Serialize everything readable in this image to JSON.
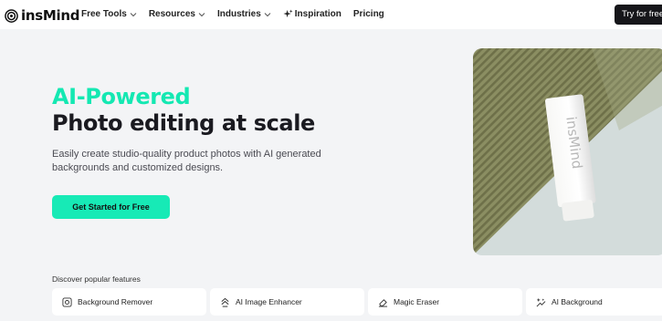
{
  "brand": {
    "name": "insMind"
  },
  "nav": {
    "items": [
      {
        "label": "Free Tools",
        "icon": "chevron-down-icon"
      },
      {
        "label": "Resources",
        "icon": "chevron-down-icon"
      },
      {
        "label": "Industries",
        "icon": "chevron-down-icon"
      },
      {
        "label": "Inspiration",
        "icon": "sparkle-icon"
      },
      {
        "label": "Pricing"
      }
    ],
    "try_label": "Try for free"
  },
  "hero": {
    "title_accent": "AI-Powered",
    "title_main": "Photo editing at scale",
    "subtitle": "Easily create studio-quality product photos with AI generated backgrounds and customized designs.",
    "cta_label": "Get Started for Free",
    "image_product_text": "insMind"
  },
  "features": {
    "heading": "Discover popular features",
    "items": [
      {
        "label": "Background Remover",
        "icon": "background-remover-icon"
      },
      {
        "label": "AI Image Enhancer",
        "icon": "enhancer-icon"
      },
      {
        "label": "Magic Eraser",
        "icon": "eraser-icon"
      },
      {
        "label": "AI Background",
        "icon": "ai-background-icon"
      }
    ]
  },
  "colors": {
    "accent": "#17eab6",
    "dark": "#16161a",
    "background": "#f3f4f6"
  }
}
